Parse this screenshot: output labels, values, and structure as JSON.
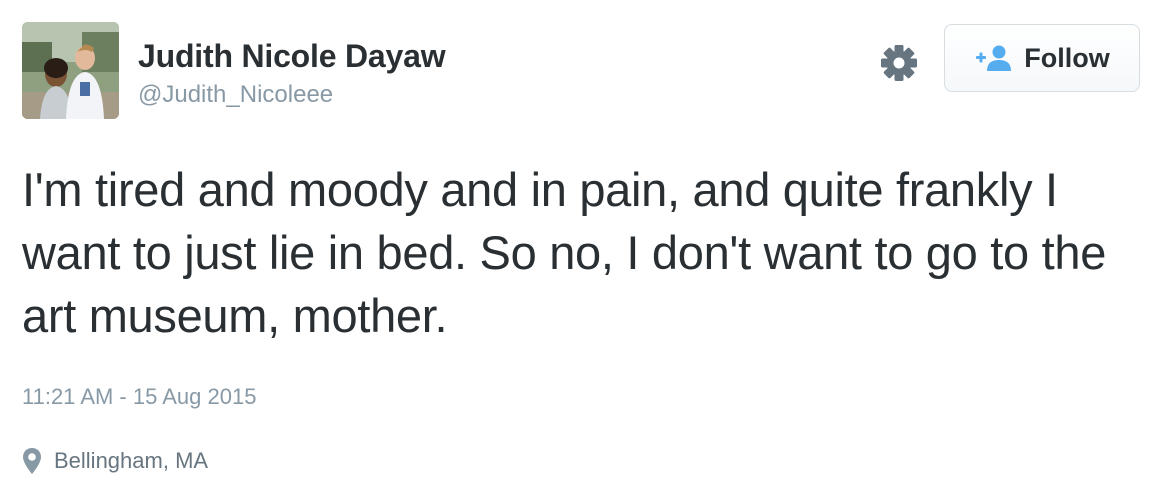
{
  "author": {
    "display_name": "Judith Nicole Dayaw",
    "handle": "@Judith_Nicoleee",
    "avatar_icon": "profile-photo"
  },
  "actions": {
    "settings_icon": "gear-icon",
    "follow_label": "Follow",
    "follow_icon": "add-user-icon"
  },
  "tweet": {
    "text": "I'm tired and moody and in pain, and quite frankly I want to just lie in bed. So no, I don't want to go to the art museum, mother.",
    "timestamp": "11:21 AM - 15 Aug 2015",
    "location": "Bellingham, MA",
    "location_icon": "map-pin-icon"
  },
  "colors": {
    "text_primary": "#292f33",
    "text_secondary": "#8899a6",
    "accent_blue": "#55acee",
    "border": "#d8dde2"
  }
}
